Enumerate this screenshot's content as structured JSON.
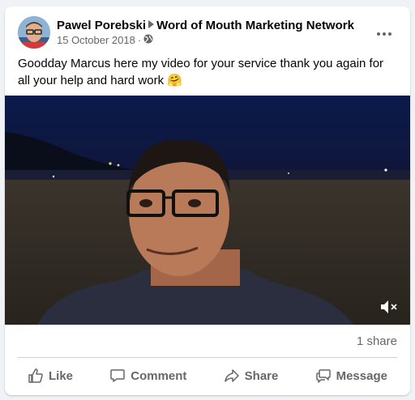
{
  "post": {
    "author": "Pawel Porebski",
    "group": "Word of Mouth Marketing Network",
    "date": "15 October 2018",
    "audience_icon": "globe-icon",
    "text": "Goodday Marcus here my video for your service thank you again for all your help and hard work",
    "emoji": "🤗",
    "shares": "1 share"
  },
  "actions": {
    "like": "Like",
    "comment": "Comment",
    "share": "Share",
    "message": "Message"
  },
  "colors": {
    "secondary_text": "#65676b",
    "divider": "#ced0d4",
    "background": "#f0f2f5"
  }
}
